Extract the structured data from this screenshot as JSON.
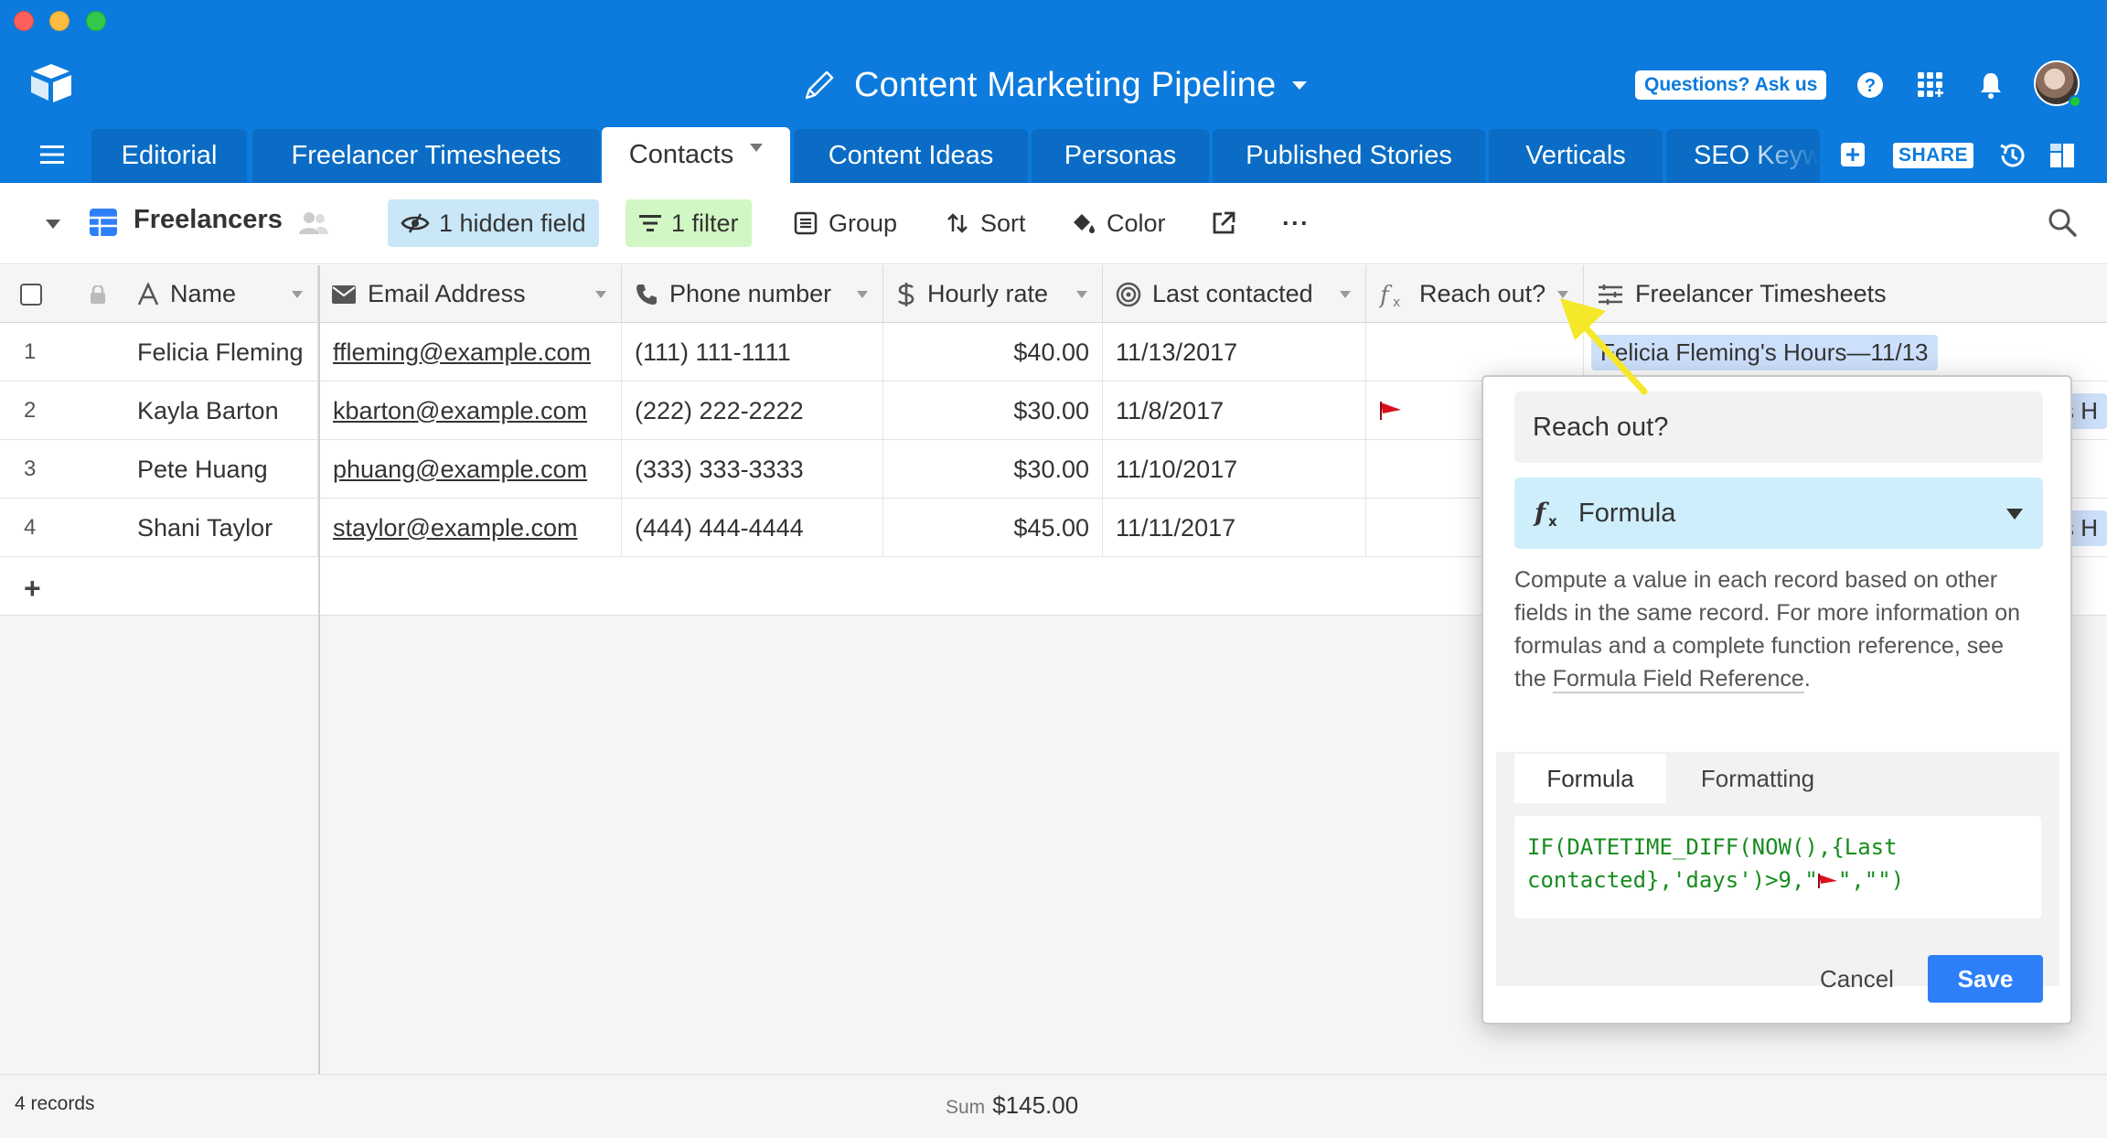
{
  "window": {
    "title": "Content Marketing Pipeline",
    "help_label": "Questions? Ask us",
    "share_label": "SHARE"
  },
  "tabs": [
    {
      "label": "Editorial"
    },
    {
      "label": "Freelancer Timesheets"
    },
    {
      "label": "Contacts",
      "active": true
    },
    {
      "label": "Content Ideas"
    },
    {
      "label": "Personas"
    },
    {
      "label": "Published Stories"
    },
    {
      "label": "Verticals"
    },
    {
      "label": "SEO Keywords"
    }
  ],
  "toolbar": {
    "view_name": "Freelancers",
    "hidden_fields": "1 hidden field",
    "filter": "1 filter",
    "group": "Group",
    "sort": "Sort",
    "color": "Color",
    "more": "···"
  },
  "columns": {
    "name": "Name",
    "email": "Email Address",
    "phone": "Phone number",
    "rate": "Hourly rate",
    "last": "Last contacted",
    "reach": "Reach out?",
    "timesheets": "Freelancer Timesheets"
  },
  "rows": [
    {
      "num": "1",
      "name": "Felicia Fleming",
      "email": "ffleming@example.com",
      "phone": "(111) 111-1111",
      "rate": "$40.00",
      "last": "11/13/2017",
      "timesheet": "Felicia Fleming's Hours—11/13"
    },
    {
      "num": "2",
      "name": "Kayla Barton",
      "email": "kbarton@example.com",
      "phone": "(222) 222-2222",
      "rate": "$30.00",
      "last": "11/8/2017",
      "timesheet": "s H"
    },
    {
      "num": "3",
      "name": "Pete Huang",
      "email": "phuang@example.com",
      "phone": "(333) 333-3333",
      "rate": "$30.00",
      "last": "11/10/2017",
      "timesheet": ""
    },
    {
      "num": "4",
      "name": "Shani Taylor",
      "email": "staylor@example.com",
      "phone": "(444) 444-4444",
      "rate": "$45.00",
      "last": "11/11/2017",
      "timesheet": "s H"
    }
  ],
  "footer": {
    "records": "4 records",
    "sum_label": "Sum",
    "sum_value": "$145.00"
  },
  "dialog": {
    "field_name": "Reach out?",
    "field_type": "Formula",
    "description": "Compute a value in each record based on other fields in the same record. For more information on formulas and a complete function reference, see the ",
    "reference_link": "Formula Field Reference",
    "description_end": ".",
    "tab_formula": "Formula",
    "tab_formatting": "Formatting",
    "formula_part1": "IF(DATETIME_DIFF(NOW(),{Last contacted},'days')>9,\"",
    "formula_part2": "\",\"\")",
    "cancel_label": "Cancel",
    "save_label": "Save"
  },
  "colors": {
    "brand_blue": "#0c7bdd",
    "save_blue": "#2d7ff9",
    "flag_red": "#d8121a",
    "code_green": "#168c1e"
  }
}
